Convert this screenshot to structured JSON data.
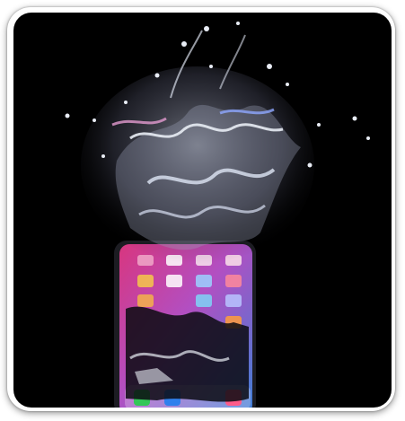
{
  "image": {
    "subject": "smartphone-splashing-into-water",
    "colors": {
      "card_background": "#ffffff",
      "photo_background": "#000000",
      "screen_pink": "#e0428f",
      "screen_blue": "#3d7fd6",
      "water_highlight": "#e8ecf4"
    }
  }
}
